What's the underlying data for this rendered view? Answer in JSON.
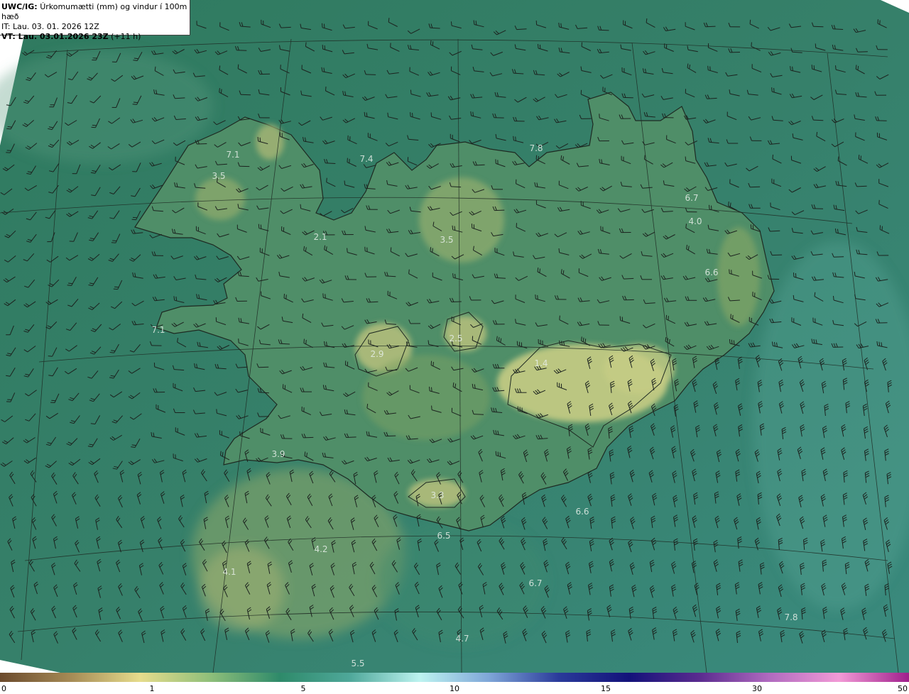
{
  "header": {
    "model": "UWC/IG:",
    "title": "Úrkomumætti (mm) og vindur í 100m hæð",
    "init_time": "IT: Lau. 03. 01. 2026 12Z",
    "valid_prefix": "VT: Lau. 03.01.2026 23Z",
    "valid_suffix": "(+11 h)"
  },
  "value_labels": [
    {
      "text": "7.1"
    },
    {
      "text": "3.5"
    },
    {
      "text": "7.4"
    },
    {
      "text": "7.8"
    },
    {
      "text": "6.7"
    },
    {
      "text": "4.0"
    },
    {
      "text": "2.1"
    },
    {
      "text": "3.5"
    },
    {
      "text": "6.6"
    },
    {
      "text": "7.1"
    },
    {
      "text": "2.9"
    },
    {
      "text": "2.5"
    },
    {
      "text": "1.4"
    },
    {
      "text": "3.9"
    },
    {
      "text": "3.3"
    },
    {
      "text": "6.6"
    },
    {
      "text": "6.5"
    },
    {
      "text": "4.2"
    },
    {
      "text": "4.1"
    },
    {
      "text": "6.7"
    },
    {
      "text": "4.7"
    },
    {
      "text": "5.5"
    },
    {
      "text": "7.8"
    }
  ],
  "colorbar": {
    "ticks": [
      "0",
      "1",
      "5",
      "10",
      "15",
      "30",
      "50"
    ],
    "colors": [
      "#6b4a2c",
      "#a58a55",
      "#e6dc8c",
      "#8fbf7a",
      "#2e8a6a",
      "#4fa89a",
      "#bdf3f0",
      "#7fa6d8",
      "#2a3a9a",
      "#13127a",
      "#5a2b8f",
      "#b06abf",
      "#f29ad6",
      "#a01f8c"
    ]
  }
}
